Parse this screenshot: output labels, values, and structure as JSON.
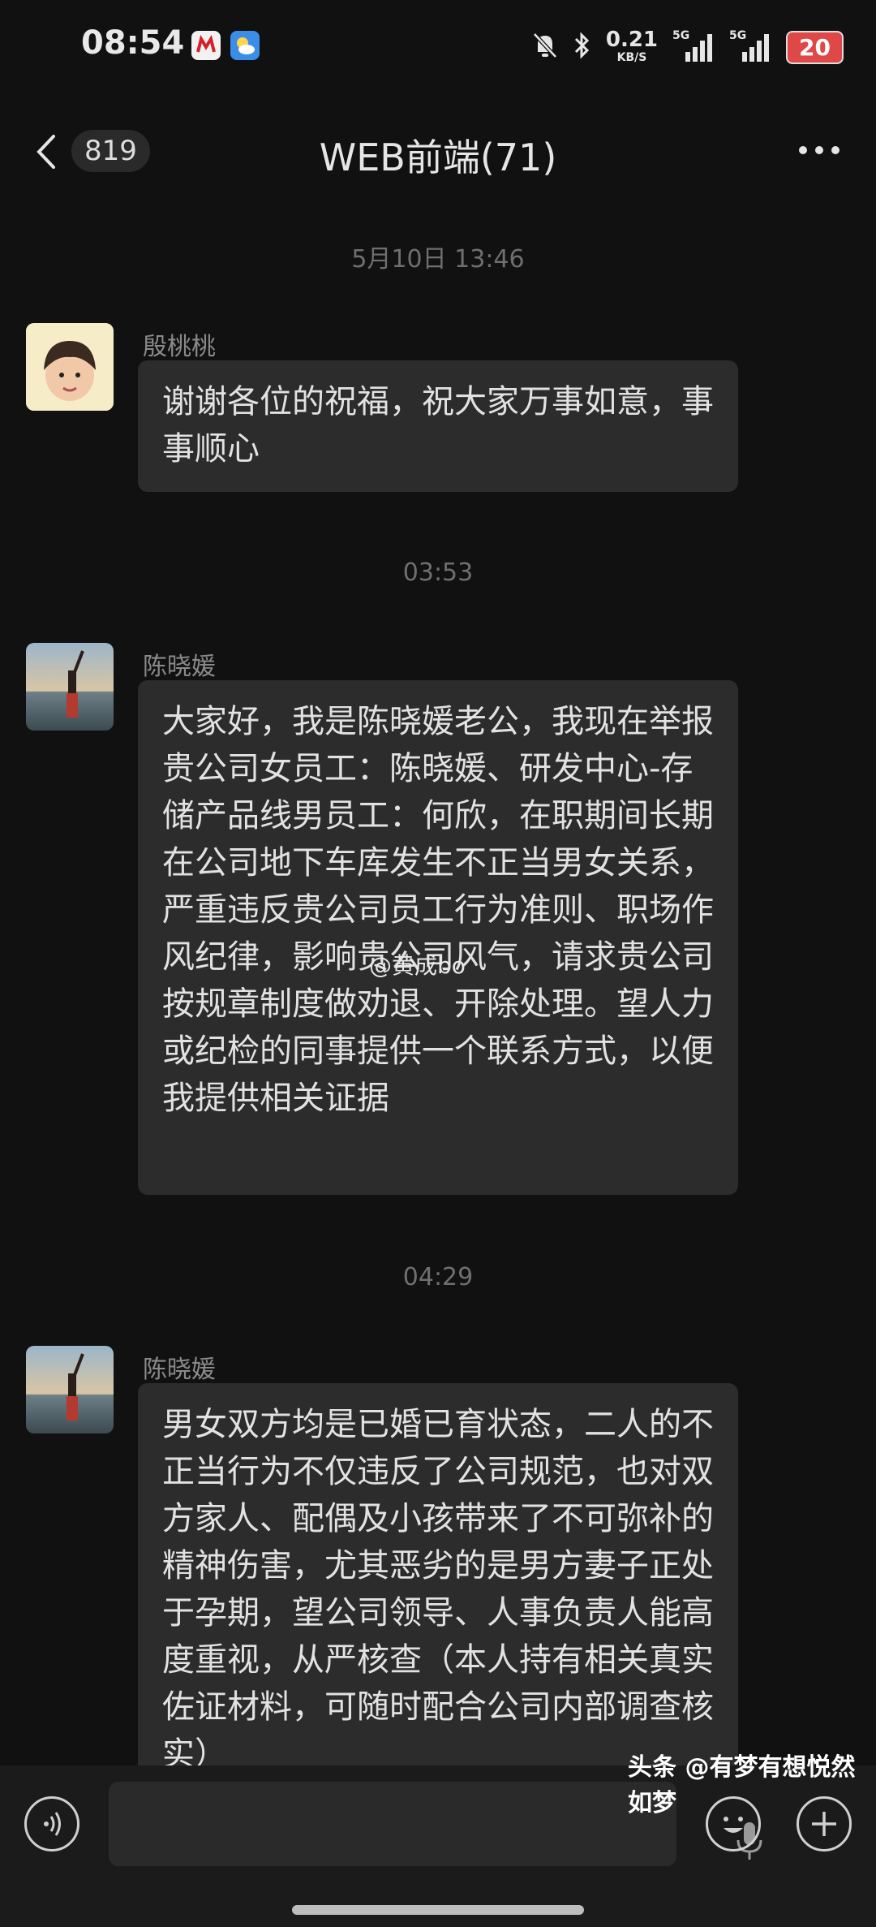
{
  "status_bar": {
    "time": "08:54",
    "net_speed_value": "0.21",
    "net_speed_unit": "KB/S",
    "signal_1": "5G",
    "signal_2": "5G",
    "battery": "20",
    "icons": [
      "china-merchants-bank-app-icon",
      "weather-app-icon",
      "mute-bell-icon",
      "bluetooth-icon",
      "signal-icon",
      "signal-icon",
      "battery-icon"
    ]
  },
  "header": {
    "unread_count": "819",
    "title": "WEB前端(71)"
  },
  "messages": [
    {
      "timestamp": "5月10日 13:46",
      "sender": "殷桃桃",
      "text": "谢谢各位的祝福，祝大家万事如意，事事顺心"
    },
    {
      "timestamp": "03:53",
      "sender": "陈晓媛",
      "text": "大家好，我是陈晓媛老公，我现在举报贵公司女员工：陈晓媛、研发中心-存储产品线男员工：何欣，在职期间长期在公司地下车库发生不正当男女关系，严重违反贵公司员工行为准则、职场作风纪律，影响贵公司风气，请求贵公司按规章制度做劝退、开除处理。望人力或纪检的同事提供一个联系方式，以便我提供相关证据"
    },
    {
      "timestamp": "04:29",
      "sender": "陈晓媛",
      "text": "男女双方均是已婚已育状态，二人的不正当行为不仅违反了公司规范，也对双方家人、配偶及小孩带来了不可弥补的精神伤害，尤其恶劣的是男方妻子正处于孕期，望公司领导、人事负责人能高度重视，从严核查（本人持有相关真实佐证材料，可随时配合公司内部调查核实）"
    }
  ],
  "watermarks": {
    "source": "头条 @有梦有想悦然如梦",
    "weibo": "@黄成bo"
  },
  "colors": {
    "background": "#111111",
    "bubble": "#2c2c2c",
    "battery_red": "#e04848"
  }
}
